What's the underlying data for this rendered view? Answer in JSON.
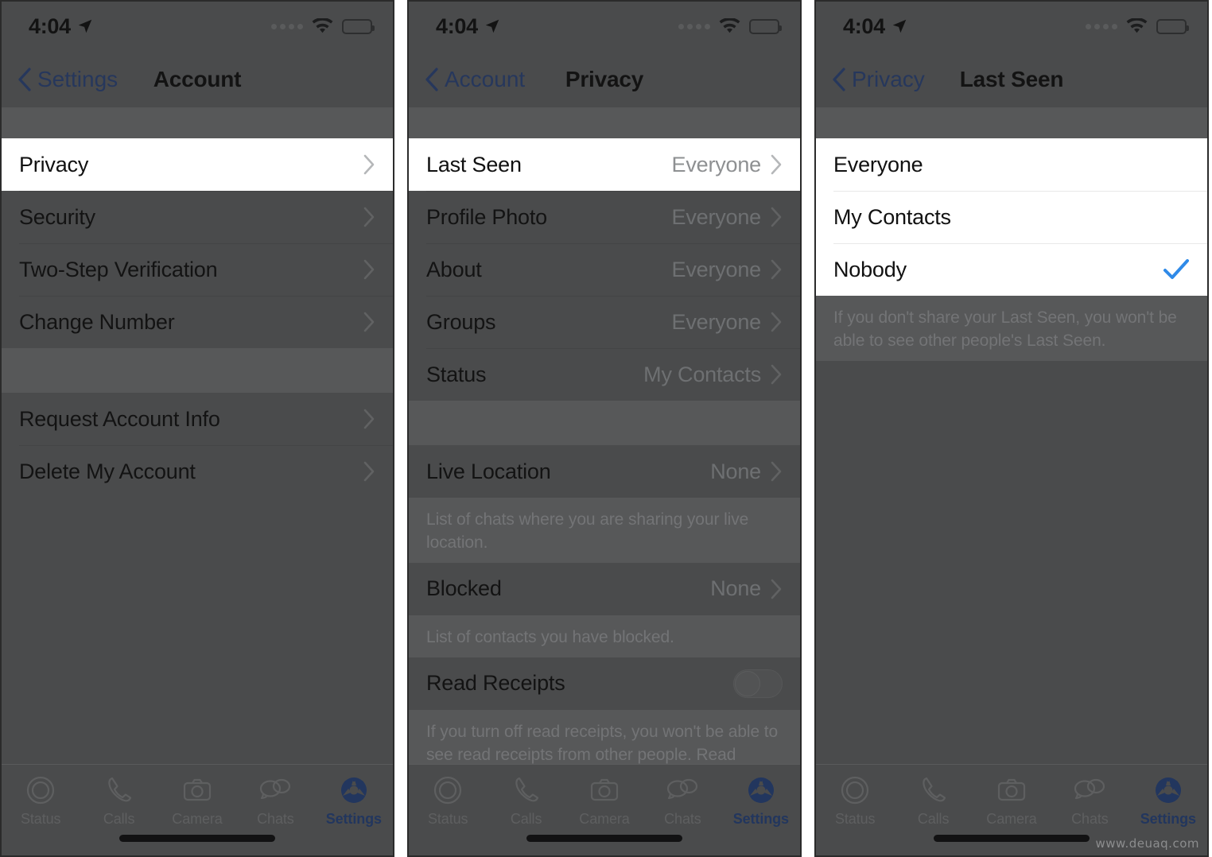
{
  "statusbar": {
    "time": "4:04",
    "location_icon": "location-arrow-icon",
    "wifi_icon": "wifi-icon",
    "battery_icon": "battery-icon",
    "signal_icon": "signal-dots-icon"
  },
  "tabbar": {
    "tabs": [
      {
        "label": "Status",
        "icon": "status-rings-icon",
        "active": false
      },
      {
        "label": "Calls",
        "icon": "phone-icon",
        "active": false
      },
      {
        "label": "Camera",
        "icon": "camera-icon",
        "active": false
      },
      {
        "label": "Chats",
        "icon": "chat-bubbles-icon",
        "active": false
      },
      {
        "label": "Settings",
        "icon": "gear-icon",
        "active": true
      }
    ]
  },
  "colors": {
    "accent_blue": "#2f8ae8",
    "dim_overlay": "#4a4b4c",
    "dim_blue": "#26375c",
    "bright_white": "#ffffff"
  },
  "screen1": {
    "nav": {
      "back_label": "Settings",
      "title": "Account"
    },
    "group1": [
      {
        "label": "Privacy",
        "value": "",
        "highlighted": true
      },
      {
        "label": "Security",
        "value": "",
        "highlighted": false
      },
      {
        "label": "Two-Step Verification",
        "value": "",
        "highlighted": false
      },
      {
        "label": "Change Number",
        "value": "",
        "highlighted": false
      }
    ],
    "group2": [
      {
        "label": "Request Account Info",
        "value": "",
        "highlighted": false
      },
      {
        "label": "Delete My Account",
        "value": "",
        "highlighted": false
      }
    ]
  },
  "screen2": {
    "nav": {
      "back_label": "Account",
      "title": "Privacy"
    },
    "group1": [
      {
        "label": "Last Seen",
        "value": "Everyone",
        "highlighted": true
      },
      {
        "label": "Profile Photo",
        "value": "Everyone",
        "highlighted": false
      },
      {
        "label": "About",
        "value": "Everyone",
        "highlighted": false
      },
      {
        "label": "Groups",
        "value": "Everyone",
        "highlighted": false
      },
      {
        "label": "Status",
        "value": "My Contacts",
        "highlighted": false
      }
    ],
    "group2": [
      {
        "label": "Live Location",
        "value": "None",
        "highlighted": false
      }
    ],
    "footnote2": "List of chats where you are sharing your live location.",
    "group3": [
      {
        "label": "Blocked",
        "value": "None",
        "highlighted": false
      }
    ],
    "footnote3": "List of contacts you have blocked.",
    "group4": [
      {
        "label": "Read Receipts",
        "value": "",
        "toggle": true,
        "toggle_on": false,
        "highlighted": false
      }
    ],
    "footnote4": "If you turn off read receipts, you won't be able to see read receipts from other people. Read receipts are always sent for group chats."
  },
  "screen3": {
    "nav": {
      "back_label": "Privacy",
      "title": "Last Seen"
    },
    "options": [
      {
        "label": "Everyone",
        "selected": false
      },
      {
        "label": "My Contacts",
        "selected": false
      },
      {
        "label": "Nobody",
        "selected": true
      }
    ],
    "footnote": "If you don't share your Last Seen, you won't be able to see other people's Last Seen."
  },
  "watermark": "www.deuaq.com"
}
